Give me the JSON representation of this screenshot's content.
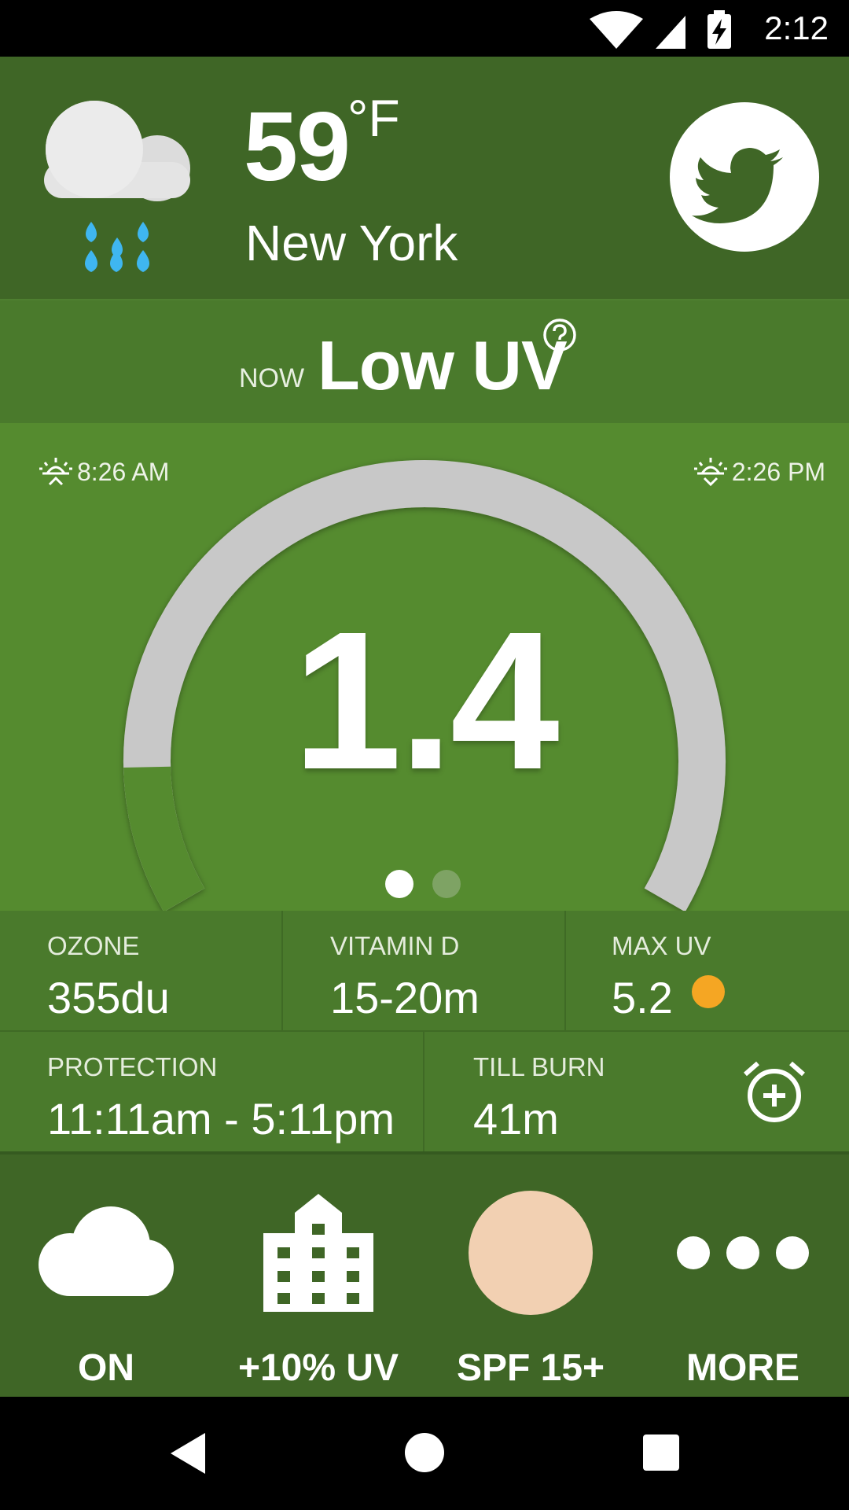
{
  "status_bar": {
    "time": "2:12",
    "icons": [
      "wifi-icon",
      "signal-icon",
      "battery-charging-icon"
    ]
  },
  "header": {
    "weather_icon": "cloud-rain-icon",
    "temperature": "59",
    "temperature_unit": "°F",
    "city": "New York",
    "share_icon": "twitter-icon"
  },
  "uv_banner": {
    "now_label": "NOW",
    "level": "Low UV",
    "help_icon": "help-icon"
  },
  "gauge": {
    "sunrise_time": "8:26 AM",
    "sunset_time": "2:26 PM",
    "uv_index": "1.4",
    "day_progress": 0.12,
    "page_count": 2,
    "active_page": 1
  },
  "stats": {
    "ozone": {
      "label": "OZONE",
      "value": "355du"
    },
    "vitamin_d": {
      "label": "VITAMIN D",
      "value": "15-20m"
    },
    "max_uv": {
      "label": "MAX UV",
      "value": "5.2",
      "indicator_color": "#f5a623"
    },
    "protection": {
      "label": "PROTECTION",
      "value": "11:11am - 5:11pm"
    },
    "till_burn": {
      "label": "TILL BURN",
      "value": "41m",
      "action_icon": "alarm-add-icon"
    }
  },
  "actions": [
    {
      "icon": "cloud-icon",
      "label": "ON"
    },
    {
      "icon": "building-icon",
      "label": "+10% UV"
    },
    {
      "icon": "skin-tone-icon",
      "label": "SPF 15+",
      "color": "#f2d0b2"
    },
    {
      "icon": "more-icon",
      "label": "MORE"
    }
  ],
  "colors": {
    "header_bg": "#3f6626",
    "banner_bg": "#4a7a2c",
    "gauge_bg": "#558b2f",
    "gauge_track": "#c8c8c8",
    "gauge_progress": "#558b2f",
    "rain_drops": "#3fb6f0"
  },
  "nav_bar": {
    "icons": [
      "back-icon",
      "home-icon",
      "recents-icon"
    ]
  }
}
